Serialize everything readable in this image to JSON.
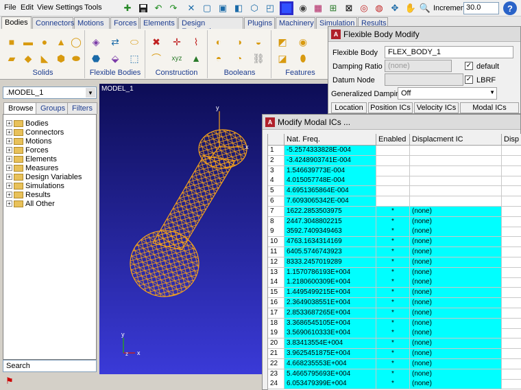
{
  "menu": {
    "file": "File",
    "edit": "Edit",
    "view": "View",
    "settings": "Settings",
    "tools": "Tools"
  },
  "toolbar": {
    "increment_label": "Increment",
    "increment_value": "30.0",
    "help": "?"
  },
  "tabs": [
    "Bodies",
    "Connectors",
    "Motions",
    "Forces",
    "Elements",
    "Design Exploration",
    "Plugins",
    "Machinery",
    "Simulation",
    "Results"
  ],
  "ribbon_groups": [
    "Solids",
    "Flexible Bodies",
    "Construction",
    "Booleans",
    "Features"
  ],
  "left": {
    "model": ".MODEL_1",
    "tabs": [
      "Browse",
      "Groups",
      "Filters"
    ],
    "tree": [
      "Bodies",
      "Connectors",
      "Motions",
      "Forces",
      "Elements",
      "Measures",
      "Design Variables",
      "Simulations",
      "Results",
      "All Other"
    ],
    "search": "Search"
  },
  "viewport": {
    "label": "MODEL_1",
    "axis_y": "y",
    "axis_x": "x",
    "axis_z": "z"
  },
  "fbm": {
    "title": "Flexible Body Modify",
    "flex_body_label": "Flexible Body",
    "flex_body_value": "FLEX_BODY_1",
    "damping_label": "Damping Ratio",
    "damping_value": "(none)",
    "default_label": "default",
    "datum_label": "Datum Node",
    "lbrf_label": "LBRF",
    "gen_damping_label": "Generalized Damping",
    "gen_damping_value": "Off",
    "subtabs": [
      "Location",
      "Position ICs",
      "Velocity ICs",
      "Modal ICs"
    ]
  },
  "mic": {
    "title": "Modify Modal ICs ...",
    "columns": [
      "Nat. Freq.",
      "Enabled",
      "Displacment IC",
      "Disp E"
    ],
    "rows": [
      {
        "n": "1",
        "freq": "-5.2574333828E-004",
        "en": "",
        "disp": ""
      },
      {
        "n": "2",
        "freq": "-3.4248903741E-004",
        "en": "",
        "disp": ""
      },
      {
        "n": "3",
        "freq": "1.546639773E-004",
        "en": "",
        "disp": ""
      },
      {
        "n": "4",
        "freq": "4.015057748E-004",
        "en": "",
        "disp": ""
      },
      {
        "n": "5",
        "freq": "4.6951365864E-004",
        "en": "",
        "disp": ""
      },
      {
        "n": "6",
        "freq": "7.6093065342E-004",
        "en": "",
        "disp": ""
      },
      {
        "n": "7",
        "freq": "1622.2853503975",
        "en": "*",
        "disp": "(none)"
      },
      {
        "n": "8",
        "freq": "2447.3048802215",
        "en": "*",
        "disp": "(none)"
      },
      {
        "n": "9",
        "freq": "3592.7409349463",
        "en": "*",
        "disp": "(none)"
      },
      {
        "n": "10",
        "freq": "4763.1634314169",
        "en": "*",
        "disp": "(none)"
      },
      {
        "n": "11",
        "freq": "6405.5746743923",
        "en": "*",
        "disp": "(none)"
      },
      {
        "n": "12",
        "freq": "8333.2457019289",
        "en": "*",
        "disp": "(none)"
      },
      {
        "n": "13",
        "freq": "1.1570786193E+004",
        "en": "*",
        "disp": "(none)"
      },
      {
        "n": "14",
        "freq": "1.2180600309E+004",
        "en": "*",
        "disp": "(none)"
      },
      {
        "n": "15",
        "freq": "1.4495499215E+004",
        "en": "*",
        "disp": "(none)"
      },
      {
        "n": "16",
        "freq": "2.3649038551E+004",
        "en": "*",
        "disp": "(none)"
      },
      {
        "n": "17",
        "freq": "2.8533687265E+004",
        "en": "*",
        "disp": "(none)"
      },
      {
        "n": "18",
        "freq": "3.3686545105E+004",
        "en": "*",
        "disp": "(none)"
      },
      {
        "n": "19",
        "freq": "3.5690610333E+004",
        "en": "*",
        "disp": "(none)"
      },
      {
        "n": "20",
        "freq": "3.83413554E+004",
        "en": "*",
        "disp": "(none)"
      },
      {
        "n": "21",
        "freq": "3.9625451875E+004",
        "en": "*",
        "disp": "(none)"
      },
      {
        "n": "22",
        "freq": "4.668235553E+004",
        "en": "*",
        "disp": "(none)"
      },
      {
        "n": "23",
        "freq": "5.4665795693E+004",
        "en": "*",
        "disp": "(none)"
      },
      {
        "n": "24",
        "freq": "6.053479399E+004",
        "en": "*",
        "disp": "(none)"
      }
    ]
  },
  "colors": {
    "cyan_cell": "#00ffff",
    "mesh": "#f5a21b",
    "viewport_top": "#0d0d55",
    "viewport_bottom": "#3a3ad8"
  }
}
